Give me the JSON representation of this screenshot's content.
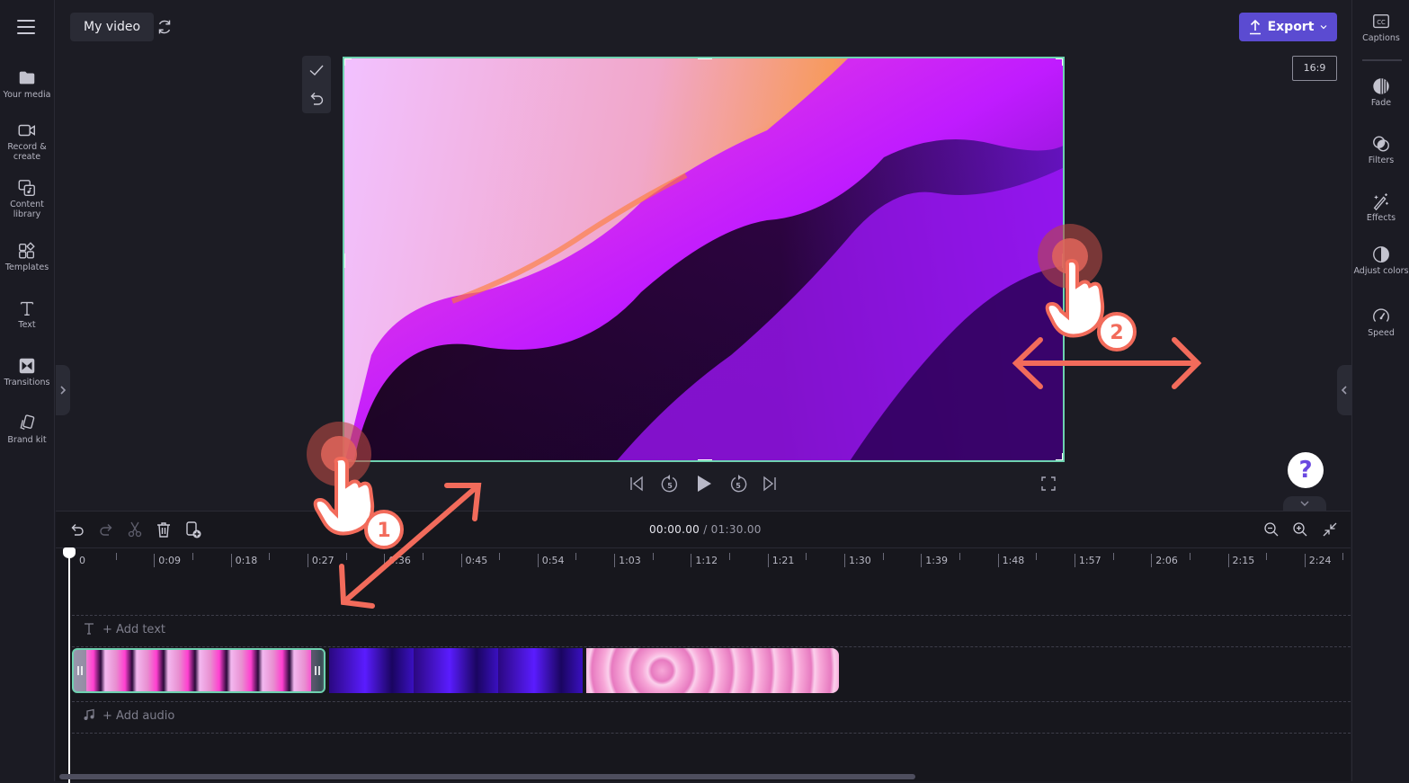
{
  "app": {
    "project_title": "My video",
    "export_label": "Export",
    "aspect_ratio": "16:9"
  },
  "left_sidebar": {
    "items": [
      {
        "label": "Your media",
        "icon": "folder-icon"
      },
      {
        "label": "Record & create",
        "icon": "video-camera-icon"
      },
      {
        "label": "Content library",
        "icon": "content-library-icon"
      },
      {
        "label": "Templates",
        "icon": "templates-icon"
      },
      {
        "label": "Text",
        "icon": "text-icon"
      },
      {
        "label": "Transitions",
        "icon": "transitions-icon"
      },
      {
        "label": "Brand kit",
        "icon": "brand-kit-icon"
      }
    ]
  },
  "right_sidebar": {
    "items": [
      {
        "label": "Captions",
        "icon": "captions-icon"
      },
      {
        "label": "Fade",
        "icon": "fade-icon"
      },
      {
        "label": "Filters",
        "icon": "filters-icon"
      },
      {
        "label": "Effects",
        "icon": "magic-wand-icon"
      },
      {
        "label": "Adjust colors",
        "icon": "contrast-icon"
      },
      {
        "label": "Speed",
        "icon": "speedometer-icon"
      }
    ]
  },
  "crop_tools": {
    "confirm": "checkmark-icon",
    "reset": "undo-icon"
  },
  "playback": {
    "skip_back_seconds": "5",
    "skip_forward_seconds": "5"
  },
  "help": {
    "label": "?"
  },
  "timeline": {
    "current_time": "00:00.00",
    "separator": " / ",
    "total_time": "01:30.00",
    "ruler_labels": [
      "0",
      "0:09",
      "0:18",
      "0:27",
      "0:36",
      "0:45",
      "0:54",
      "1:03",
      "1:12",
      "1:21",
      "1:30",
      "1:39",
      "1:48",
      "1:57",
      "2:06",
      "2:15",
      "2:24"
    ],
    "text_track_label": "+ Add text",
    "audio_track_label": "+ Add audio",
    "clips": [
      {
        "name": "pink-wave-clip",
        "selected": true
      },
      {
        "name": "purple-waves-clip",
        "selected": false
      },
      {
        "name": "pink-bubbles-clip",
        "selected": false
      }
    ]
  },
  "annotations": {
    "step_1": "1",
    "step_2": "2",
    "accent_color": "#f26b5b"
  },
  "colors": {
    "export_button": "#5b4bd1",
    "crop_border": "#6ed2b0",
    "background": "#1c1c24"
  }
}
